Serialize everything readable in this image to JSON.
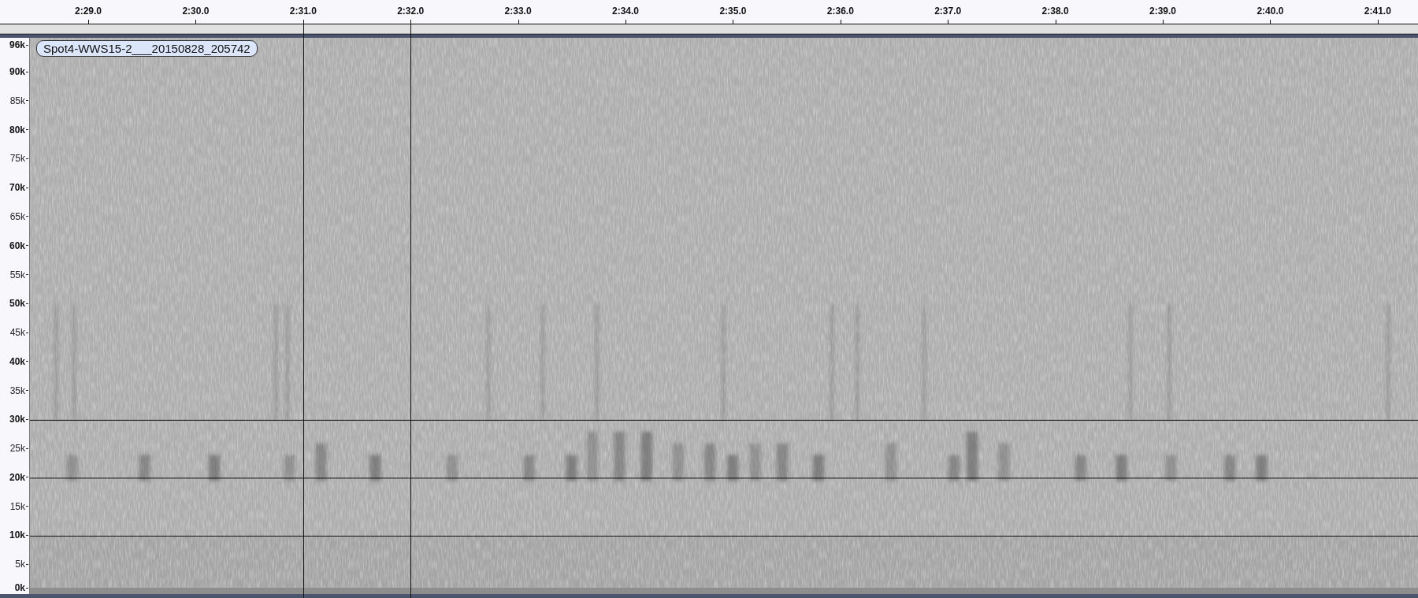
{
  "ruler": {
    "ticks": [
      "2:29.0",
      "2:30.0",
      "2:31.0",
      "2:32.0",
      "2:33.0",
      "2:34.0",
      "2:35.0",
      "2:36.0",
      "2:37.0",
      "2:38.0",
      "2:39.0",
      "2:40.0",
      "2:41.0"
    ]
  },
  "frequency_axis": {
    "labels": [
      {
        "text": "96k",
        "major": true
      },
      {
        "text": "90k",
        "major": true
      },
      {
        "text": "85k",
        "major": false
      },
      {
        "text": "80k",
        "major": true
      },
      {
        "text": "75k",
        "major": false
      },
      {
        "text": "70k",
        "major": true
      },
      {
        "text": "65k",
        "major": false
      },
      {
        "text": "60k",
        "major": true
      },
      {
        "text": "55k",
        "major": false
      },
      {
        "text": "50k",
        "major": true
      },
      {
        "text": "45k",
        "major": false
      },
      {
        "text": "40k",
        "major": true
      },
      {
        "text": "35k",
        "major": false
      },
      {
        "text": "30k",
        "major": true
      },
      {
        "text": "25k",
        "major": false
      },
      {
        "text": "20k",
        "major": true
      },
      {
        "text": "15k",
        "major": false
      },
      {
        "text": "10k",
        "major": true
      },
      {
        "text": "5k",
        "major": false
      },
      {
        "text": "0k",
        "major": true
      }
    ]
  },
  "track": {
    "name": "Spot4-WWS15-2___20150828_205742"
  }
}
